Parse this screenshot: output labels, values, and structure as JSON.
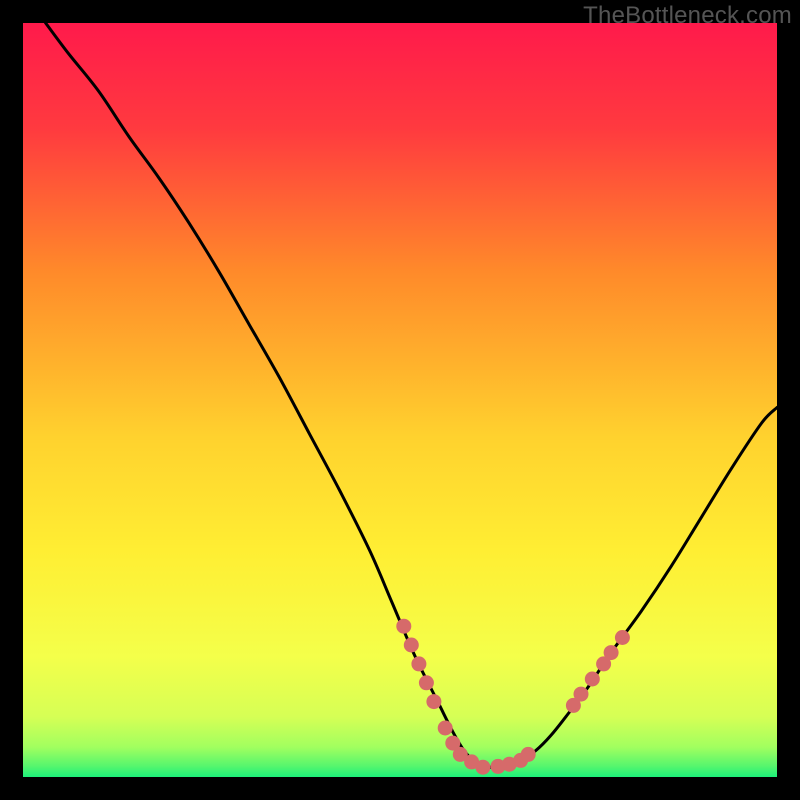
{
  "watermark": "TheBottleneck.com",
  "colors": {
    "top": "#ff1a4b",
    "mid_upper": "#ff8a2a",
    "mid": "#ffe831",
    "mid_lower": "#f5ff4d",
    "bottom": "#1df07a",
    "curve": "#000000",
    "markers": "#d66a6a",
    "background": "#000000"
  },
  "chart_data": {
    "type": "line",
    "title": "",
    "xlabel": "",
    "ylabel": "",
    "xlim": [
      0,
      100
    ],
    "ylim": [
      0,
      100
    ],
    "grid": false,
    "legend": false,
    "series": [
      {
        "name": "bottleneck-curve",
        "x": [
          3,
          6,
          10,
          14,
          18,
          22,
          26,
          30,
          34,
          38,
          42,
          46,
          49,
          52,
          55,
          57,
          58.5,
          60,
          62,
          64,
          66,
          68,
          70,
          72,
          75,
          78,
          82,
          86,
          90,
          94,
          98,
          100
        ],
        "y": [
          100,
          96,
          91,
          85,
          79.5,
          73.5,
          67,
          60,
          53,
          45.5,
          38,
          30,
          23,
          16,
          10,
          6,
          3.5,
          2,
          1.3,
          1.5,
          2.2,
          3.5,
          5.5,
          8,
          12,
          16.5,
          22,
          28,
          34.5,
          41,
          47,
          49
        ]
      }
    ],
    "markers": [
      {
        "x": 50.5,
        "y": 20
      },
      {
        "x": 51.5,
        "y": 17.5
      },
      {
        "x": 52.5,
        "y": 15
      },
      {
        "x": 53.5,
        "y": 12.5
      },
      {
        "x": 54.5,
        "y": 10
      },
      {
        "x": 56,
        "y": 6.5
      },
      {
        "x": 57,
        "y": 4.5
      },
      {
        "x": 58,
        "y": 3
      },
      {
        "x": 59.5,
        "y": 2
      },
      {
        "x": 61,
        "y": 1.3
      },
      {
        "x": 63,
        "y": 1.4
      },
      {
        "x": 64.5,
        "y": 1.7
      },
      {
        "x": 66,
        "y": 2.2
      },
      {
        "x": 67,
        "y": 3
      },
      {
        "x": 73,
        "y": 9.5
      },
      {
        "x": 74,
        "y": 11
      },
      {
        "x": 75.5,
        "y": 13
      },
      {
        "x": 77,
        "y": 15
      },
      {
        "x": 78,
        "y": 16.5
      },
      {
        "x": 79.5,
        "y": 18.5
      }
    ]
  }
}
